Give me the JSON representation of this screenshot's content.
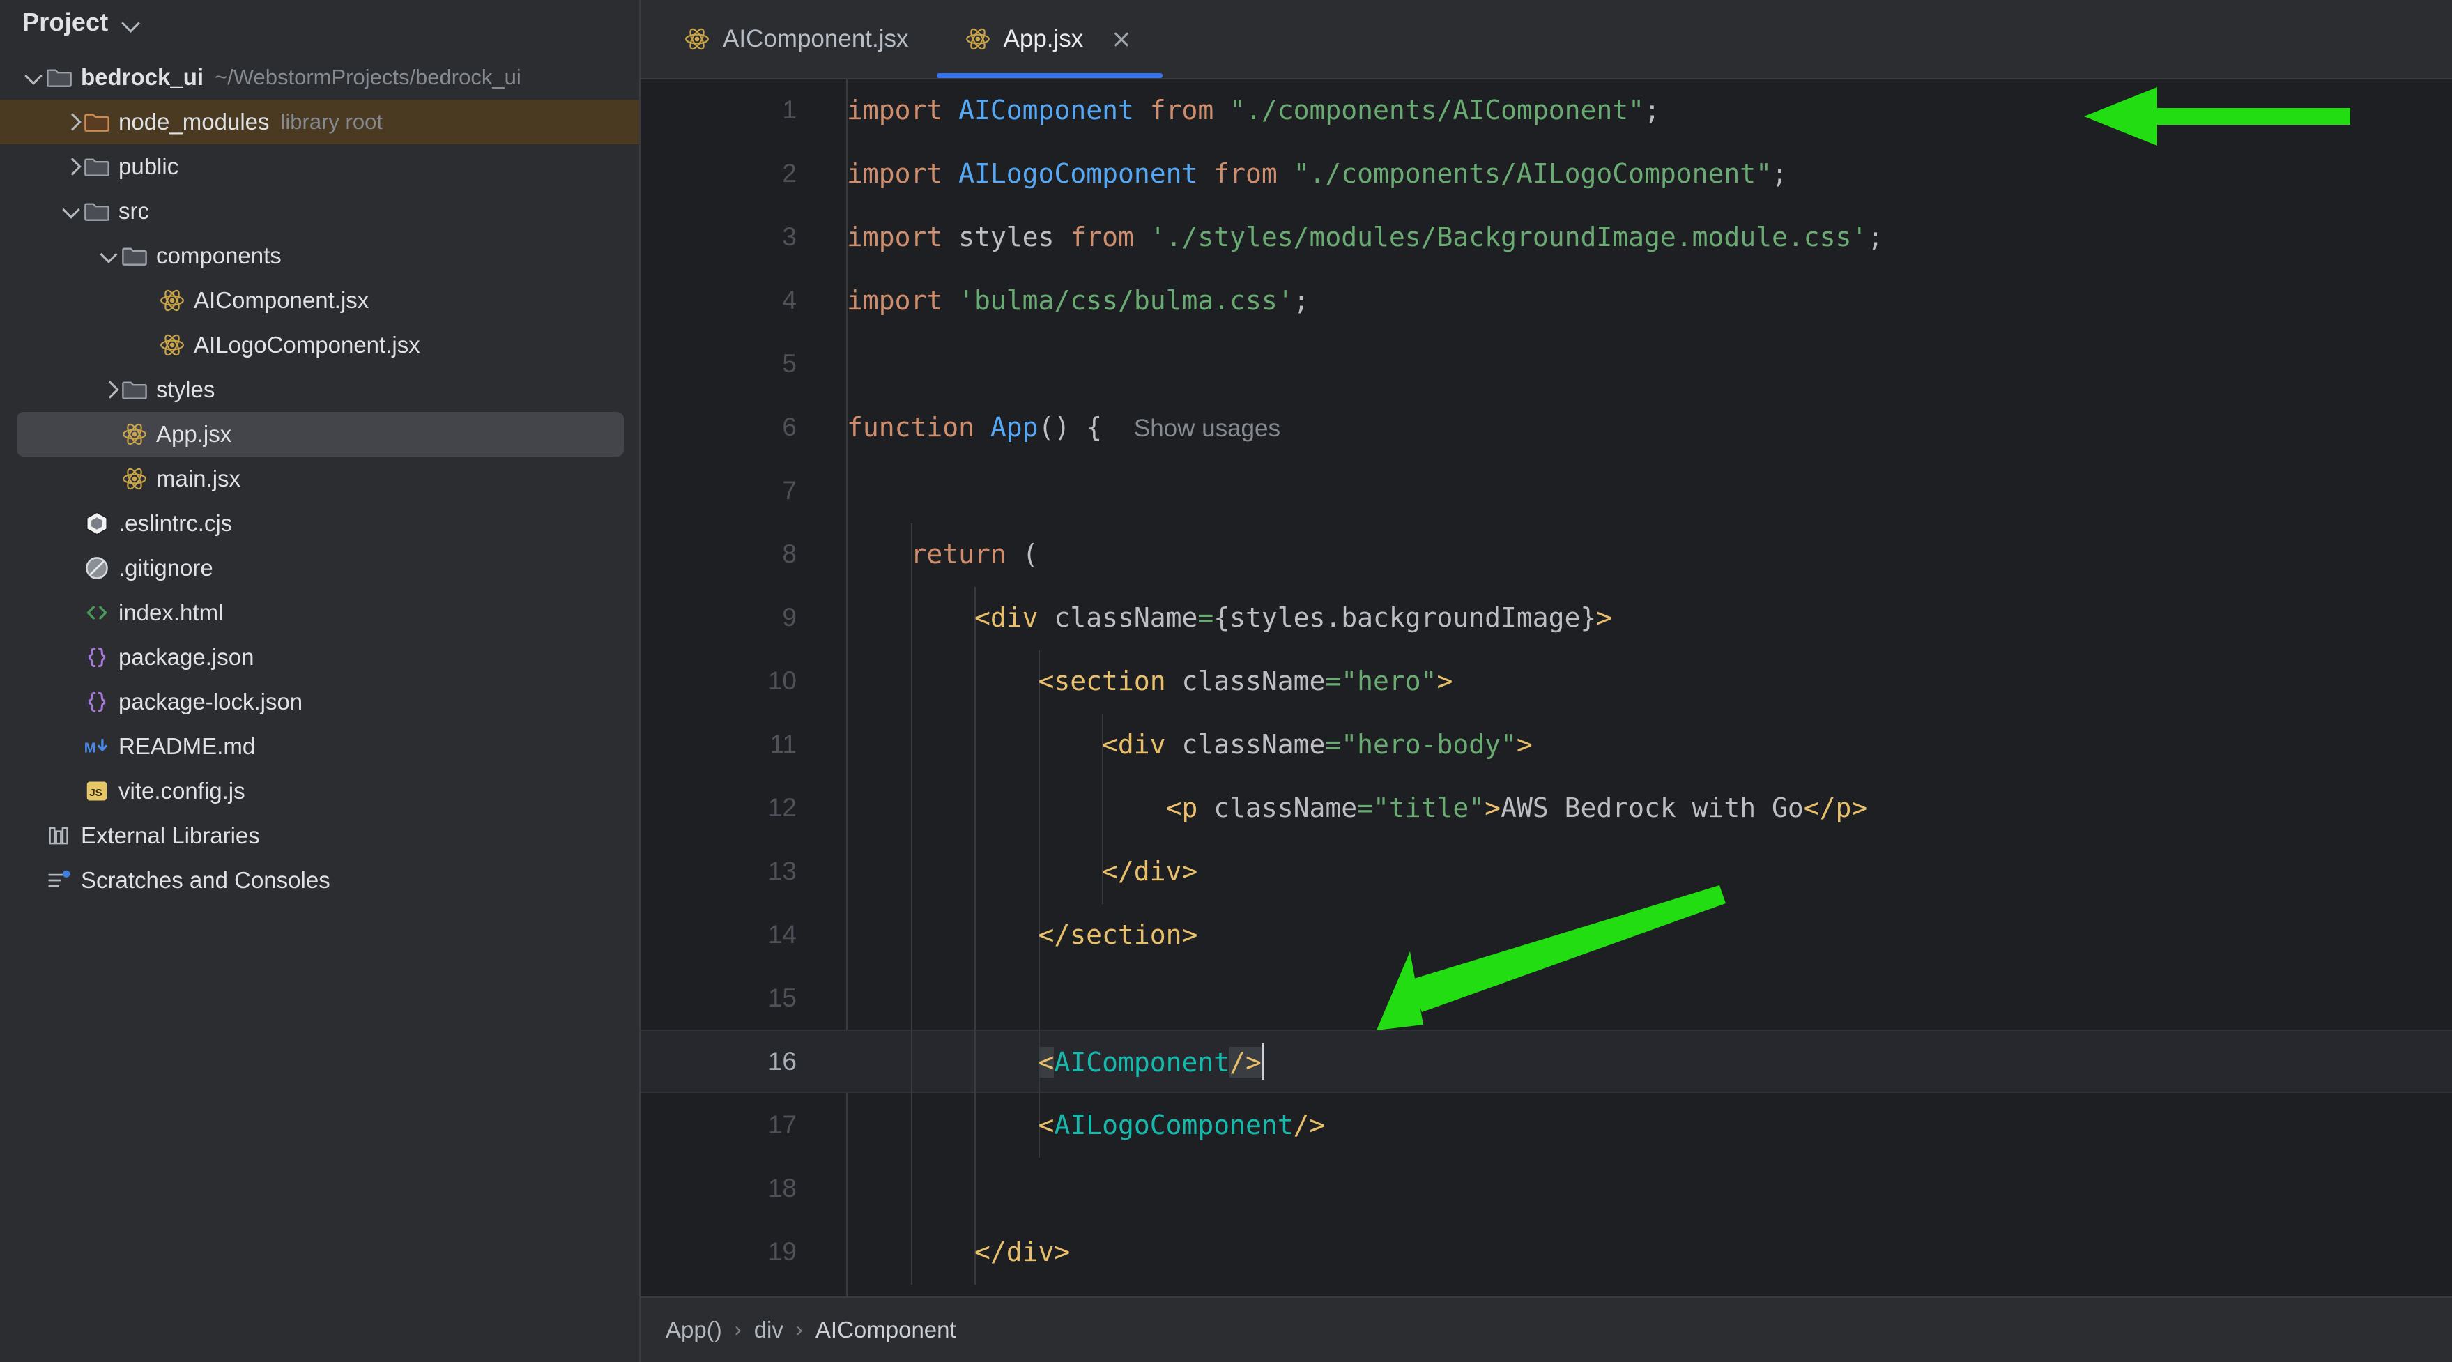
{
  "sidebar": {
    "header": {
      "title": "Project",
      "chevron_icon": "chevron-down-icon"
    },
    "tree": [
      {
        "label": "bedrock_ui",
        "sub": "~/WebstormProjects/bedrock_ui",
        "icon": "folder-icon",
        "twisty": "down",
        "indent": 0,
        "bold": true,
        "state": "normal"
      },
      {
        "label": "node_modules",
        "sub": "library root",
        "icon": "folder-orange-icon",
        "twisty": "right",
        "indent": 1,
        "bold": false,
        "state": "node-modules"
      },
      {
        "label": "public",
        "sub": "",
        "icon": "folder-icon",
        "twisty": "right",
        "indent": 1,
        "bold": false,
        "state": "normal"
      },
      {
        "label": "src",
        "sub": "",
        "icon": "folder-icon",
        "twisty": "down",
        "indent": 1,
        "bold": false,
        "state": "normal"
      },
      {
        "label": "components",
        "sub": "",
        "icon": "folder-icon",
        "twisty": "down",
        "indent": 2,
        "bold": false,
        "state": "normal"
      },
      {
        "label": "AIComponent.jsx",
        "sub": "",
        "icon": "react-icon",
        "twisty": "none",
        "indent": 3,
        "bold": false,
        "state": "normal"
      },
      {
        "label": "AILogoComponent.jsx",
        "sub": "",
        "icon": "react-icon",
        "twisty": "none",
        "indent": 3,
        "bold": false,
        "state": "normal"
      },
      {
        "label": "styles",
        "sub": "",
        "icon": "folder-icon",
        "twisty": "right",
        "indent": 2,
        "bold": false,
        "state": "normal"
      },
      {
        "label": "App.jsx",
        "sub": "",
        "icon": "react-icon",
        "twisty": "none",
        "indent": 2,
        "bold": false,
        "state": "selected"
      },
      {
        "label": "main.jsx",
        "sub": "",
        "icon": "react-icon",
        "twisty": "none",
        "indent": 2,
        "bold": false,
        "state": "normal"
      },
      {
        "label": ".eslintrc.cjs",
        "sub": "",
        "icon": "eslint-icon",
        "twisty": "none",
        "indent": 1,
        "bold": false,
        "state": "normal"
      },
      {
        "label": ".gitignore",
        "sub": "",
        "icon": "gitignore-icon",
        "twisty": "none",
        "indent": 1,
        "bold": false,
        "state": "normal"
      },
      {
        "label": "index.html",
        "sub": "",
        "icon": "html-icon",
        "twisty": "none",
        "indent": 1,
        "bold": false,
        "state": "normal"
      },
      {
        "label": "package.json",
        "sub": "",
        "icon": "json-icon",
        "twisty": "none",
        "indent": 1,
        "bold": false,
        "state": "normal"
      },
      {
        "label": "package-lock.json",
        "sub": "",
        "icon": "json-icon",
        "twisty": "none",
        "indent": 1,
        "bold": false,
        "state": "normal"
      },
      {
        "label": "README.md",
        "sub": "",
        "icon": "markdown-icon",
        "twisty": "none",
        "indent": 1,
        "bold": false,
        "state": "normal"
      },
      {
        "label": "vite.config.js",
        "sub": "",
        "icon": "js-icon",
        "twisty": "none",
        "indent": 1,
        "bold": false,
        "state": "normal"
      },
      {
        "label": "External Libraries",
        "sub": "",
        "icon": "library-icon",
        "twisty": "none",
        "indent": 0,
        "bold": false,
        "state": "normal"
      },
      {
        "label": "Scratches and Consoles",
        "sub": "",
        "icon": "scratches-icon",
        "twisty": "none",
        "indent": 0,
        "bold": false,
        "state": "normal"
      }
    ]
  },
  "tabs": [
    {
      "label": "AIComponent.jsx",
      "icon": "react-icon",
      "active": false,
      "closable": false
    },
    {
      "label": "App.jsx",
      "icon": "react-icon",
      "active": true,
      "closable": true
    }
  ],
  "editor": {
    "language": "jsx",
    "caret_line": 16,
    "inlay_hint": "Show usages",
    "lines": [
      {
        "n": "1",
        "text": "import AIComponent from \"./components/AIComponent\";"
      },
      {
        "n": "2",
        "text": "import AILogoComponent from \"./components/AILogoComponent\";"
      },
      {
        "n": "3",
        "text": "import styles from './styles/modules/BackgroundImage.module.css';"
      },
      {
        "n": "4",
        "text": "import 'bulma/css/bulma.css';"
      },
      {
        "n": "5",
        "text": ""
      },
      {
        "n": "6",
        "text": "function App() {"
      },
      {
        "n": "7",
        "text": ""
      },
      {
        "n": "8",
        "text": "    return ("
      },
      {
        "n": "9",
        "text": "        <div className={styles.backgroundImage}>"
      },
      {
        "n": "10",
        "text": "            <section className=\"hero\">"
      },
      {
        "n": "11",
        "text": "                <div className=\"hero-body\">"
      },
      {
        "n": "12",
        "text": "                    <p className=\"title\">AWS Bedrock with Go</p>"
      },
      {
        "n": "13",
        "text": "                </div>"
      },
      {
        "n": "14",
        "text": "            </section>"
      },
      {
        "n": "15",
        "text": ""
      },
      {
        "n": "16",
        "text": "            <AIComponent/>"
      },
      {
        "n": "17",
        "text": "            <AILogoComponent/>"
      },
      {
        "n": "18",
        "text": ""
      },
      {
        "n": "19",
        "text": "        </div>"
      }
    ]
  },
  "breadcrumb": [
    {
      "label": "App()"
    },
    {
      "label": "div"
    },
    {
      "label": "AIComponent"
    }
  ],
  "annotations": {
    "arrow_color": "#22dd11",
    "arrows": [
      {
        "name": "arrow-to-import-line",
        "points_to": "line 1 import AIComponent"
      },
      {
        "name": "arrow-to-aicomponent-tag",
        "points_to": "line 16 <AIComponent/>"
      }
    ]
  },
  "colors": {
    "sidebar_bg": "#2b2d30",
    "editor_bg": "#1e1f22",
    "accent_tab": "#3574f0",
    "keyword": "#cf8e6d",
    "identifier": "#56a8f5",
    "string": "#6aab73",
    "tag": "#e8bf6a",
    "component": "#16baac",
    "arrow_green": "#22dd11",
    "node_modules_highlight": "#4a3a22",
    "selection_bg": "#43454a"
  }
}
